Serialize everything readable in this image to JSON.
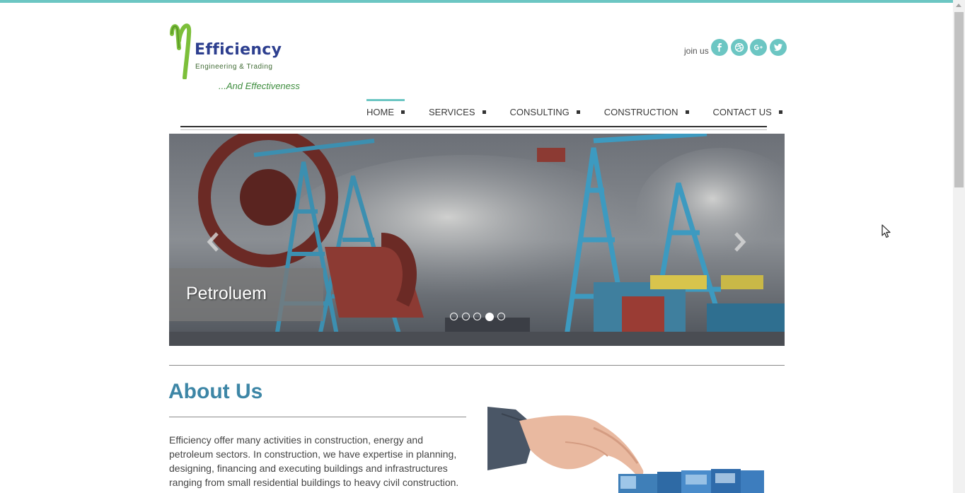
{
  "logo": {
    "brand": "Efficiency",
    "subtitle": "Engineering & Trading",
    "tagline": "...And Effectiveness"
  },
  "social": {
    "join_label": "join us",
    "icons": [
      "facebook-icon",
      "dribbble-icon",
      "google-plus-icon",
      "twitter-icon"
    ]
  },
  "nav": {
    "items": [
      {
        "label": "HOME",
        "active": true
      },
      {
        "label": "SERVICES",
        "active": false
      },
      {
        "label": "CONSULTING",
        "active": false
      },
      {
        "label": "CONSTRUCTION",
        "active": false
      },
      {
        "label": "CONTACT US",
        "active": false
      }
    ]
  },
  "slider": {
    "caption": "Petroluem",
    "slide_count": 5,
    "active_slide": 4
  },
  "about": {
    "title": "About Us",
    "text": "Efficiency offer many activities in construction, energy and petroleum sectors. In construction, we have expertise in planning, designing, financing and executing buildings and infrastructures ranging from small residential buildings to heavy civil construction."
  },
  "colors": {
    "accent": "#6cc6c3",
    "title": "#3d86a6",
    "brand": "#2d3f8f",
    "tagline": "#3e8d3e"
  }
}
